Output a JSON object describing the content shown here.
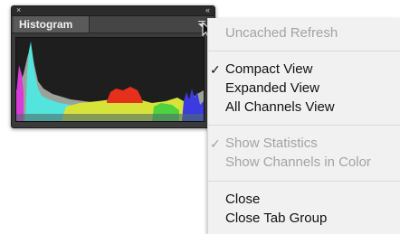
{
  "panel": {
    "close_glyph": "×",
    "collapse_glyph": "«",
    "tab_label": "Histogram",
    "icons": [
      "close-icon",
      "collapse-icon",
      "panel-menu-icon"
    ]
  },
  "menu": {
    "items": [
      {
        "label": "Uncached Refresh",
        "enabled": false,
        "checked": false
      },
      {
        "label": "Compact View",
        "enabled": true,
        "checked": true
      },
      {
        "label": "Expanded View",
        "enabled": true,
        "checked": false
      },
      {
        "label": "All Channels View",
        "enabled": true,
        "checked": false
      },
      {
        "label": "Show Statistics",
        "enabled": false,
        "checked": true
      },
      {
        "label": "Show Channels in Color",
        "enabled": false,
        "checked": false
      },
      {
        "label": "Close",
        "enabled": true,
        "checked": false
      },
      {
        "label": "Close Tab Group",
        "enabled": true,
        "checked": false
      }
    ],
    "check_glyph": "✓"
  },
  "colors": {
    "panel_bg": "#3a3a3a",
    "menu_bg": "#f1f1f1",
    "hist_gray": "#9aa29a",
    "hist_yellow": "#d8e33a",
    "hist_cyan": "#4fe8e0",
    "hist_red": "#e5301c",
    "hist_blue": "#3b3bdf",
    "hist_magenta": "#d93bd9"
  }
}
